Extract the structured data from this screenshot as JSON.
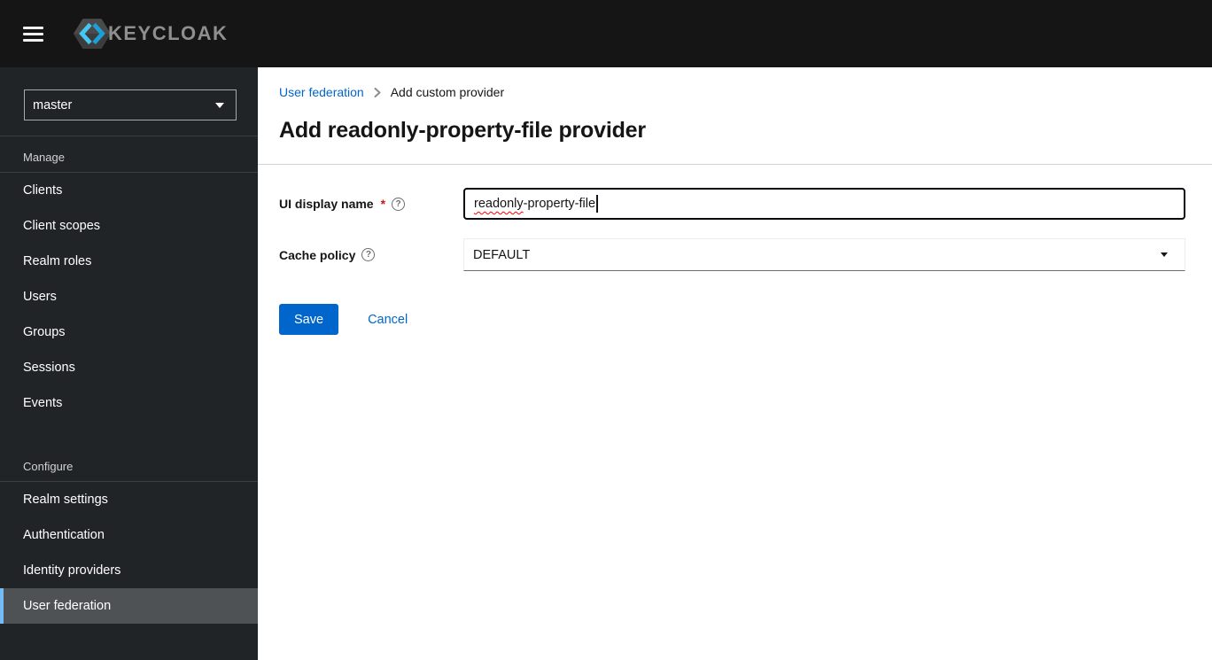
{
  "header": {
    "app_name": "KEYCLOAK"
  },
  "sidebar": {
    "realm_selector": {
      "value": "master"
    },
    "sections": [
      {
        "title": "Manage",
        "items": [
          {
            "label": "Clients"
          },
          {
            "label": "Client scopes"
          },
          {
            "label": "Realm roles"
          },
          {
            "label": "Users"
          },
          {
            "label": "Groups"
          },
          {
            "label": "Sessions"
          },
          {
            "label": "Events"
          }
        ]
      },
      {
        "title": "Configure",
        "items": [
          {
            "label": "Realm settings"
          },
          {
            "label": "Authentication"
          },
          {
            "label": "Identity providers"
          },
          {
            "label": "User federation",
            "active": true
          }
        ]
      }
    ]
  },
  "breadcrumb": {
    "items": [
      {
        "label": "User federation"
      },
      {
        "label": "Add custom provider"
      }
    ]
  },
  "page": {
    "title": "Add readonly-property-file provider"
  },
  "form": {
    "fields": [
      {
        "label": "UI display name",
        "required_indicator": "*",
        "value": "readonly-property-file",
        "value_misspelled": "readonly",
        "value_rest": "-property-file"
      },
      {
        "label": "Cache policy",
        "value": "DEFAULT"
      }
    ],
    "actions": {
      "save": "Save",
      "cancel": "Cancel"
    }
  },
  "icons": {
    "help": "?"
  },
  "colors": {
    "header_bg": "#151515",
    "sidebar_bg": "#212427",
    "nav_current_bg": "#4f5255",
    "nav_current_indicator": "#73bcf7",
    "link": "#0066cc",
    "primary_button": "#0066cc",
    "required": "#c9190b",
    "spellcheck_underline": "#ff0000",
    "divider": "#d2d2d2"
  }
}
